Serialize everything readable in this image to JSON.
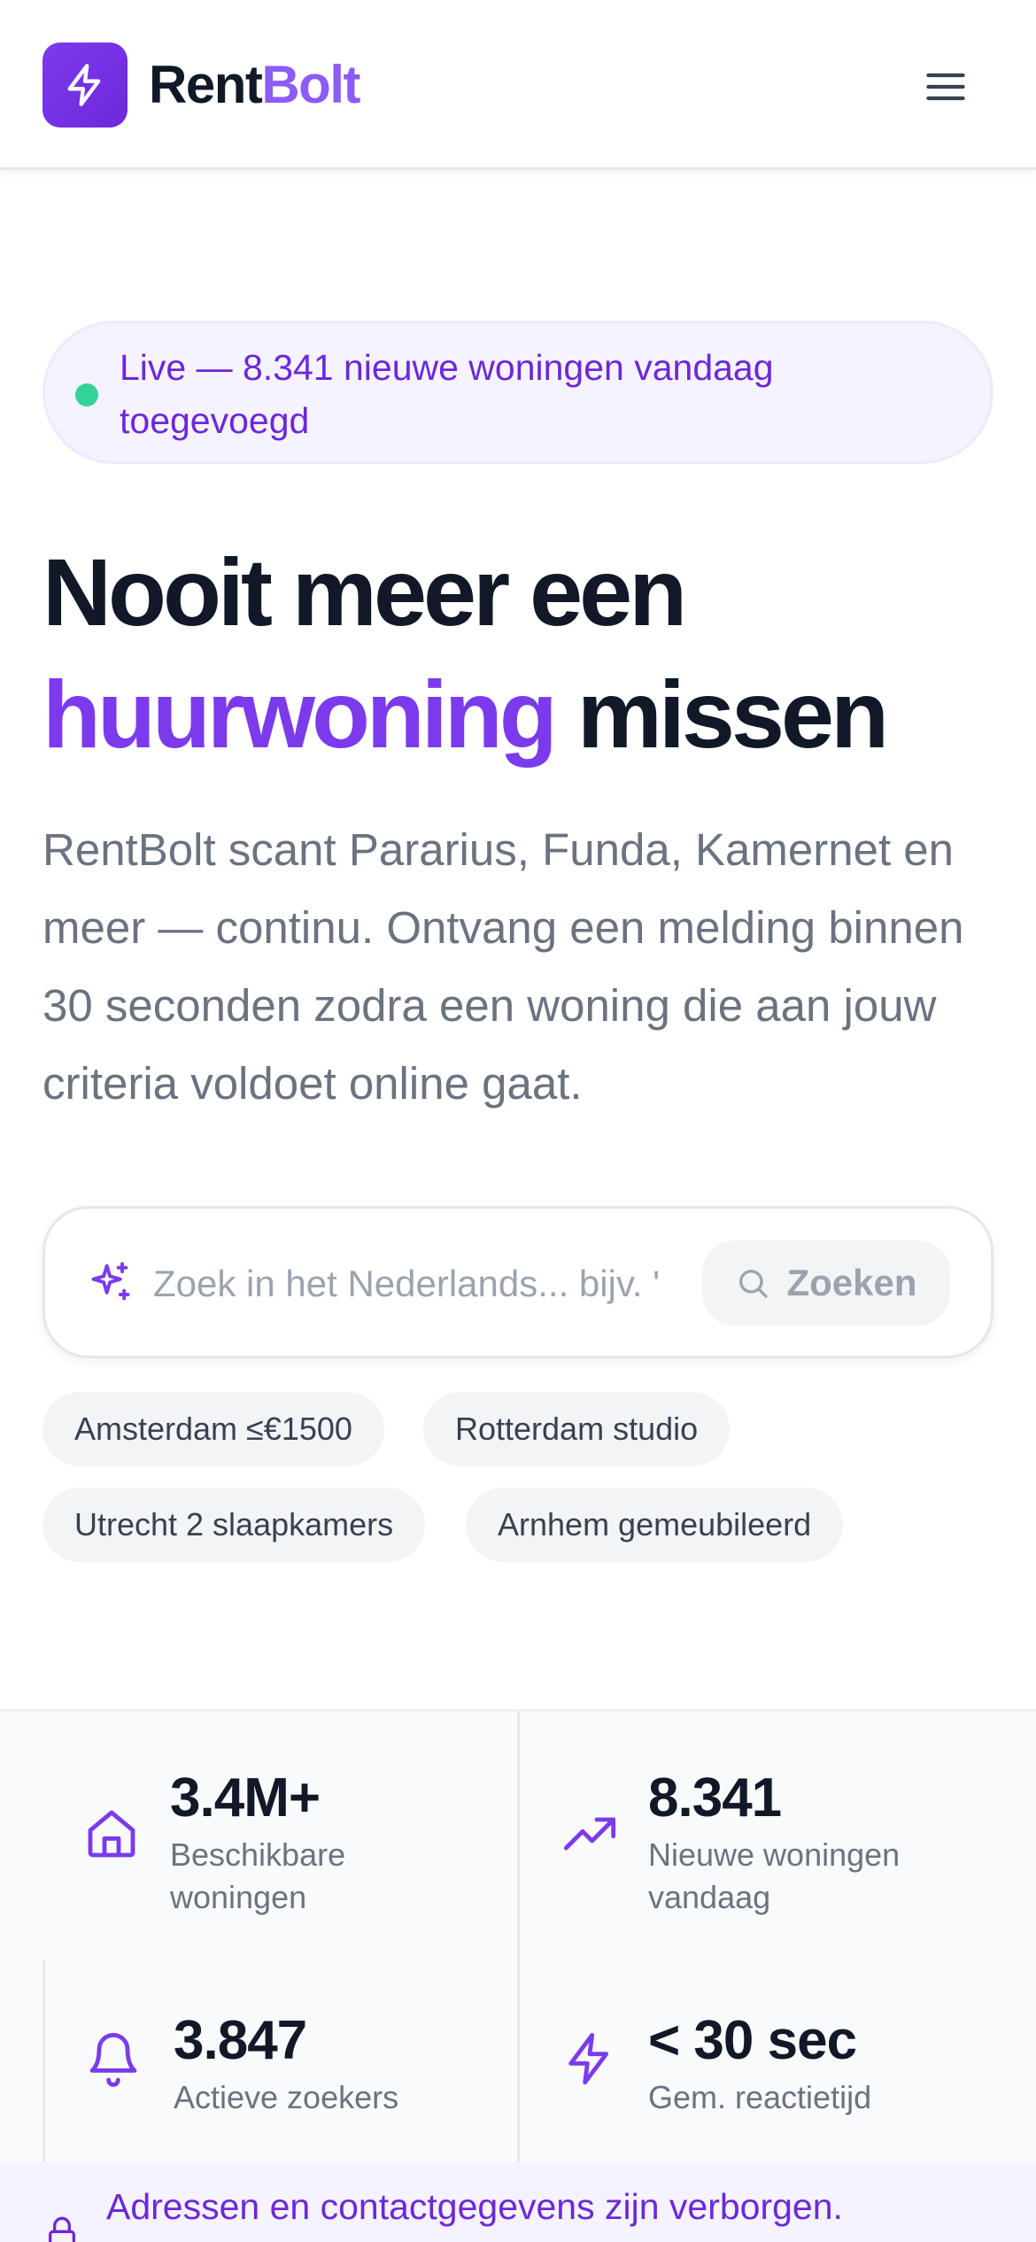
{
  "header": {
    "brand_part1": "Rent",
    "brand_part2": "Bolt",
    "logo_icon": "bolt-icon",
    "menu_icon": "hamburger-menu-icon"
  },
  "live_banner": {
    "text": "Live — 8.341 nieuwe woningen vandaag toegevoegd",
    "status_color": "#34d399"
  },
  "hero": {
    "title_line1": "Nooit meer een",
    "title_accent": "huurwoning",
    "title_rest": " missen",
    "subtitle": "RentBolt scant Pararius, Funda, Kamernet en meer — continu. Ontvang een melding binnen 30 seconden zodra een woning die aan jouw criteria voldoet online gaat."
  },
  "search": {
    "placeholder": "Zoek in het Nederlands... bijv. '",
    "value": "",
    "button_label": "Zoeken",
    "icon": "sparkles-icon"
  },
  "suggestions": [
    "Amsterdam ≤€1500",
    "Rotterdam studio",
    "Utrecht 2 slaapkamers",
    "Arnhem gemeubileerd"
  ],
  "stats": [
    {
      "icon": "home-icon",
      "value": "3.4M+",
      "label": "Beschikbare woningen"
    },
    {
      "icon": "trending-up-icon",
      "value": "8.341",
      "label": "Nieuwe woningen vandaag"
    },
    {
      "icon": "bell-icon",
      "value": "3.847",
      "label": "Actieve zoekers"
    },
    {
      "icon": "bolt-icon",
      "value": "< 30 sec",
      "label": "Gem. reactietijd"
    }
  ],
  "privacy_banner": {
    "text": "Adressen en contactgegevens zijn verborgen.",
    "icon": "lock-icon"
  },
  "colors": {
    "accent": "#7c3aed",
    "accent_light": "#8b5cf6",
    "text_dark": "#111827",
    "text_muted": "#6b7280"
  }
}
